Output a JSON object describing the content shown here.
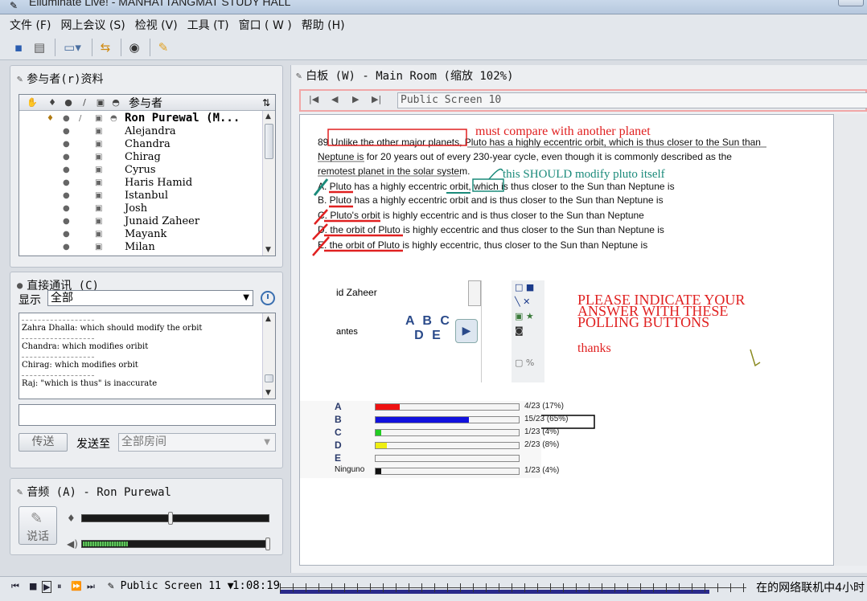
{
  "window": {
    "title": "Elluminate Live! - MANHATTANGMAT STUDY HALL"
  },
  "menu": [
    "文件 (F)",
    "网上会议 (S)",
    "检视 (V)",
    "工具 (T)",
    "窗口 ( W )",
    "帮助 (H)"
  ],
  "participants": {
    "title": "参与者(r)资料",
    "column_header": "参与者",
    "items": [
      "Ron Purewal (M...",
      "Alejandra",
      "Chandra",
      "Chirag",
      "Cyrus",
      "Haris Hamid",
      "Istanbul",
      "Josh",
      "Junaid Zaheer",
      "Mayank",
      "Milan"
    ]
  },
  "chat": {
    "title": "直接通讯 (C)",
    "filter_label": "显示",
    "filter_value": "全部",
    "messages": [
      "Zahra Dhalla: which should modify the orbit",
      "Chandra: which modifies oribit",
      "Chirag: which modifies orbit",
      "Raj: \"which is thus\" is inaccurate"
    ],
    "send_label": "传送",
    "send_to_label": "发送至",
    "send_to_value": "全部房间"
  },
  "audio": {
    "title": "音频 (A) - Ron Purewal",
    "talk_label": "说话",
    "mic_level": 0.46,
    "speaker_level": 0.24
  },
  "whiteboard": {
    "title": "白板 (W) - Main Room (缩放 102%)",
    "screen_field": "Public Screen 10",
    "question": {
      "number_line": "89  Unlike the other major planets, Pluto has a highly eccentric orbit, which is thus closer to the Sun than",
      "line2": "Neptune is for 20 years out of every 230-year cycle, even though it is commonly described as the",
      "line3": "remotest planet in the solar system.",
      "choices": [
        "A. Pluto has a highly eccentric orbit, which is thus closer to the Sun than Neptune is",
        "B. Pluto has a highly eccentric orbit and is thus closer to the Sun than Neptune is",
        "C. Pluto's orbit is highly eccentric and is thus closer to the Sun than Neptune",
        "D. the orbit of Pluto is highly eccentric and thus closer to the Sun than Neptune is",
        "E. the orbit of Pluto is highly eccentric, thus closer to the Sun than Neptune is"
      ]
    },
    "annotations": {
      "compare": "must compare with another planet",
      "modify": "this SHOULD modify pluto itself",
      "indicate": [
        "PLEASE INDICATE YOUR",
        "ANSWER WITH THESE",
        "POLLING BUTTONS"
      ],
      "thanks": "thanks"
    },
    "poll_image": {
      "name": "id Zaheer",
      "antes": "antes",
      "letters_top": "A B C",
      "letters_bottom": "D E"
    },
    "poll_results": [
      {
        "label": "A",
        "value": "4/23 (17%)",
        "pct": 17,
        "color": "#ee1111"
      },
      {
        "label": "B",
        "value": "15/23 (65%)",
        "pct": 65,
        "color": "#1111dd"
      },
      {
        "label": "C",
        "value": "1/23 (4%)",
        "pct": 4,
        "color": "#22cc22"
      },
      {
        "label": "D",
        "value": "2/23 (8%)",
        "pct": 8,
        "color": "#eeee11"
      },
      {
        "label": "E",
        "value": "",
        "pct": 0,
        "color": "#999999"
      },
      {
        "label": "Ninguno",
        "value": "1/23 (4%)",
        "pct": 4,
        "color": "#111111"
      }
    ]
  },
  "bottom": {
    "screen": "Public Screen 11",
    "time": "1:08:19",
    "status": "在的网络联机中4小时",
    "timeline_progress": 0.92
  },
  "colors": {
    "annotation_red": "#e02020",
    "annotation_teal": "#1a8a7a",
    "poll_highlight": "#000000"
  }
}
